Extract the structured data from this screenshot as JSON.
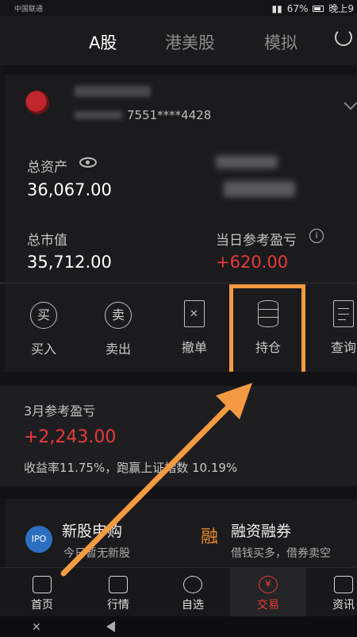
{
  "status_bar": {
    "carrier": "中国联通",
    "battery": "67%",
    "time": "晚上9"
  },
  "top_tabs": [
    {
      "label": "A股",
      "active": true
    },
    {
      "label": "港美股",
      "active": false
    },
    {
      "label": "模拟",
      "active": false
    }
  ],
  "account": {
    "number": "7551****4428"
  },
  "assets": {
    "total_label": "总资产",
    "total_value": "36,067.00",
    "market_label": "总市值",
    "market_value": "35,712.00",
    "daily_label": "当日参考盈亏",
    "daily_value": "+620.00"
  },
  "actions": [
    {
      "label": "买入",
      "icon_char": "买",
      "icon": "buy-icon"
    },
    {
      "label": "卖出",
      "icon_char": "卖",
      "icon": "sell-icon"
    },
    {
      "label": "撤单",
      "icon": "cancel-order-icon"
    },
    {
      "label": "持仓",
      "icon": "position-database-icon"
    },
    {
      "label": "查询",
      "icon": "query-document-icon"
    }
  ],
  "month": {
    "label": "3月参考盈亏",
    "value": "+2,243.00",
    "rate_text": "收益率11.75%，跑赢上证指数 10.19%"
  },
  "services": [
    {
      "icon_text": "IPO",
      "title": "新股申购",
      "sub": "今日暂无新股"
    },
    {
      "icon_text": "融",
      "title": "融资融券",
      "sub": "借钱买多，借券卖空"
    }
  ],
  "bottom_nav": [
    {
      "label": "首页",
      "icon": "home-icon"
    },
    {
      "label": "行情",
      "icon": "chart-icon"
    },
    {
      "label": "自选",
      "icon": "user-icon"
    },
    {
      "label": "交易",
      "icon_char": "¥",
      "icon": "trade-icon",
      "active": true
    },
    {
      "label": "资讯",
      "icon": "news-icon"
    }
  ],
  "colors": {
    "up_red": "#e63b3b",
    "highlight_orange": "#f39a43",
    "background": "#1b1b1d"
  }
}
